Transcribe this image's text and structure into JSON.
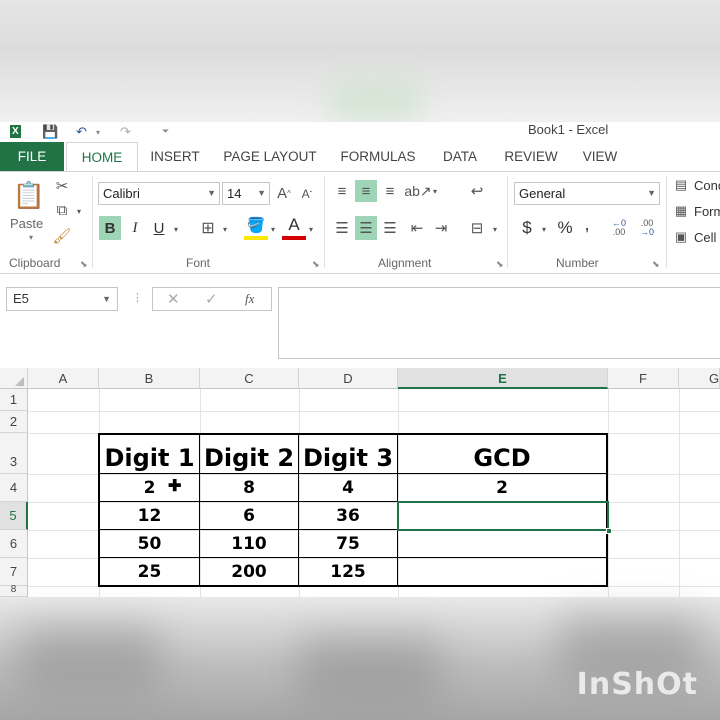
{
  "window": {
    "title": "Book1 - Excel"
  },
  "tabs": [
    "FILE",
    "HOME",
    "INSERT",
    "PAGE LAYOUT",
    "FORMULAS",
    "DATA",
    "REVIEW",
    "VIEW"
  ],
  "ribbon": {
    "clipboard": {
      "label": "Clipboard",
      "paste": "Paste"
    },
    "font": {
      "label": "Font",
      "name": "Calibri",
      "size": "14",
      "bold": "B",
      "italic": "I",
      "underline": "U",
      "grow": "A",
      "shrink": "A",
      "font_color_letter": "A"
    },
    "alignment": {
      "label": "Alignment"
    },
    "number": {
      "label": "Number",
      "format": "General",
      "currency": "$",
      "percent": "%",
      "comma": ",",
      "inc_dec": ".00",
      "dec_dec": ".00"
    },
    "styles": {
      "conditional": "Conc",
      "format_table": "Form",
      "cell_styles": "Cell"
    }
  },
  "formula_bar": {
    "name_box": "E5",
    "fx": "fx",
    "value": ""
  },
  "grid": {
    "columns": [
      "A",
      "B",
      "C",
      "D",
      "E",
      "F",
      "G"
    ],
    "rows": [
      "1",
      "2",
      "3",
      "4",
      "5",
      "6",
      "7",
      "8"
    ],
    "selected_column": "E",
    "selected_row": "5",
    "table": {
      "headers": [
        "Digit 1",
        "Digit 2",
        "Digit 3",
        "GCD"
      ],
      "rows": [
        [
          "2",
          "8",
          "4",
          "2"
        ],
        [
          "12",
          "6",
          "36",
          ""
        ],
        [
          "50",
          "110",
          "75",
          ""
        ],
        [
          "25",
          "200",
          "125",
          ""
        ]
      ]
    }
  },
  "watermark": "InShOt",
  "colors": {
    "accent": "#217346",
    "selected_button": "#9fd5b7"
  }
}
